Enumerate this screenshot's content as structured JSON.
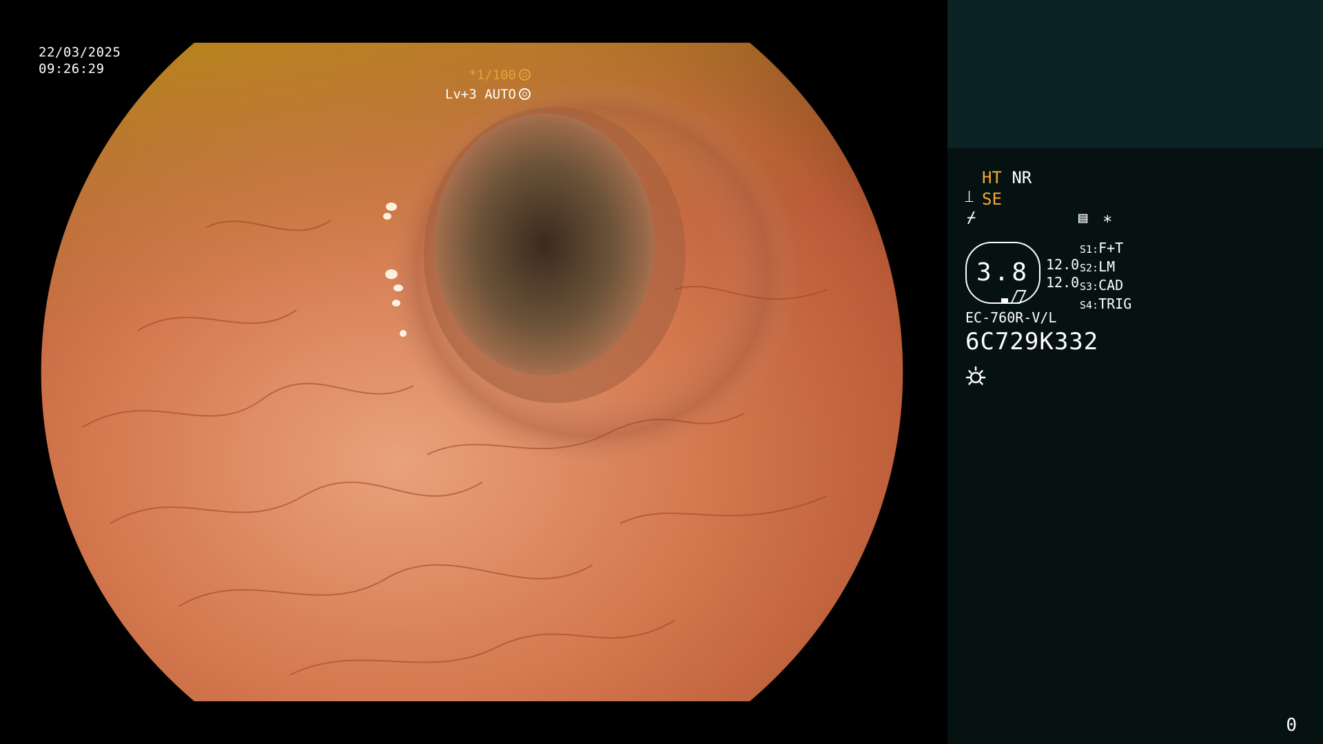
{
  "overlay": {
    "date": "22/03/2025",
    "time": "09:26:29",
    "exposure": "*1/100",
    "exposure_icon": "shutter-icon",
    "level": "Lv+3 AUTO",
    "level_icon": "iris-icon"
  },
  "panel": {
    "mode_ht": "HT",
    "mode_nr": "NR",
    "mode_se": "SE",
    "se_icon": "structure-enhance-icon",
    "freeze_icon": "freeze-icon",
    "memo_icon": "record-icon",
    "asterisk": "*",
    "zoom_value": "3.8",
    "zoom_range_1": "12.0",
    "zoom_range_2": "12.0",
    "switches": [
      {
        "key": "S1:",
        "label": "F+T"
      },
      {
        "key": "S2:",
        "label": "LM"
      },
      {
        "key": "S3:",
        "label": "CAD"
      },
      {
        "key": "S4:",
        "label": "TRIG"
      }
    ],
    "scope_model": "EC-760R-V/L",
    "serial_number": "6C729K332",
    "light_icon": "sun-icon",
    "frame_counter": "0"
  },
  "colors": {
    "panel_top": "#0c2325",
    "panel_bg": "#061211",
    "accent": "#f0a933"
  }
}
